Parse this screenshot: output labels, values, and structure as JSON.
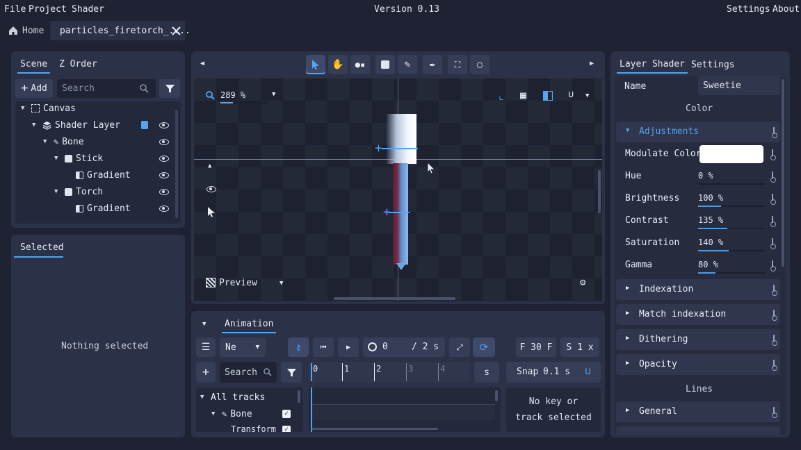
{
  "menu": {
    "file": "File",
    "project": "Project",
    "shader": "Shader",
    "version": "Version 0.13",
    "settings": "Settings",
    "about": "About"
  },
  "tabs": {
    "home": "Home",
    "file": "particles_firetorch_...."
  },
  "scene": {
    "tab_scene": "Scene",
    "tab_zorder": "Z Order",
    "add_label": "Add",
    "search_placeholder": "Search",
    "tree": [
      {
        "label": "Canvas"
      },
      {
        "label": "Shader Layer"
      },
      {
        "label": "Bone"
      },
      {
        "label": "Stick"
      },
      {
        "label": "Gradient"
      },
      {
        "label": "Torch"
      },
      {
        "label": "Gradient"
      }
    ]
  },
  "selected": {
    "tab": "Selected",
    "empty": "Nothing selected"
  },
  "viewport": {
    "zoom": "289 %",
    "preview": "Preview"
  },
  "animation": {
    "tab": "Animation",
    "mode": "Ne",
    "time": "0",
    "duration": "/ 2 s",
    "fps": "F 30 F",
    "speed": "S 1 x",
    "search_placeholder": "Search",
    "snap_label": "Snap",
    "snap_value": "0.1 s",
    "ticks": [
      "0",
      "1",
      "2",
      "3",
      "4"
    ],
    "unit": "s",
    "tracks": {
      "all": "All tracks",
      "bone": "Bone",
      "transform": "Transform"
    },
    "empty": "No key or track selected"
  },
  "inspector": {
    "tab_layer": "Layer Shader",
    "tab_settings": "Settings",
    "name_label": "Name",
    "name_value": "Sweetie",
    "color_header": "Color",
    "adjustments": "Adjustments",
    "modulate_label": "Modulate Color",
    "modulate_color": "#ffffff",
    "props": [
      {
        "label": "Hue",
        "value": "0 %",
        "fill": 0.0
      },
      {
        "label": "Brightness",
        "value": "100 %",
        "fill": 0.34
      },
      {
        "label": "Contrast",
        "value": "135 %",
        "fill": 0.44
      },
      {
        "label": "Saturation",
        "value": "140 %",
        "fill": 0.46
      },
      {
        "label": "Gamma",
        "value": "80 %",
        "fill": 0.26
      }
    ],
    "sections": [
      "Indexation",
      "Match indexation",
      "Dithering",
      "Opacity"
    ],
    "lines_header": "Lines",
    "general": "General"
  },
  "colors": {
    "accent": "#57a4ec",
    "panel": "#2b3147",
    "background": "#1e2233"
  }
}
